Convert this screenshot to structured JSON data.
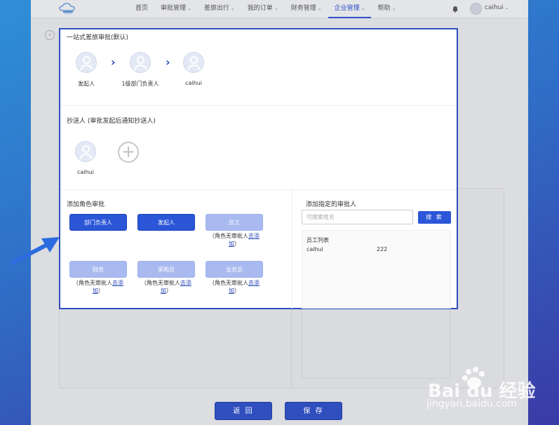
{
  "nav": {
    "items": [
      "首页",
      "审批管理",
      "差旅出行",
      "我的订单",
      "财务管理",
      "企业管理",
      "帮助"
    ],
    "user": "caihui"
  },
  "flow": {
    "title": "一站式差旅审批(默认)",
    "nodes": [
      "发起人",
      "1级部门负责人",
      "caihui"
    ]
  },
  "cc": {
    "title": "抄送人 (审批发起后通知抄送人)",
    "nodes": [
      "caihui"
    ]
  },
  "roles": {
    "title": "添加角色审批",
    "buttons": [
      "部门负责人",
      "发起人",
      "员工",
      "财务",
      "采购员",
      "业务员"
    ],
    "note_prefix": "（角色无审批人",
    "note_link_1": "去添",
    "note_link_2": "加",
    "note_suffix": "）"
  },
  "approver": {
    "title": "添加指定的审批人",
    "search_placeholder": "可搜索姓名",
    "search_button": "搜 索",
    "list_header": "员工列表",
    "employee_name": "caihui",
    "employee_id": "222"
  },
  "footer": {
    "back": "返 回",
    "save": "保 存"
  },
  "watermark": {
    "brand": "Bai du 经验",
    "url": "jingyan.baidu.com"
  }
}
